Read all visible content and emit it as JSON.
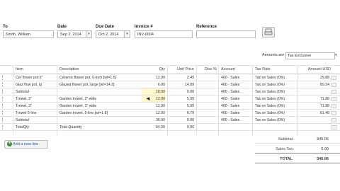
{
  "header": {
    "to_label": "To",
    "to_value": "Smith, William",
    "date_label": "Date",
    "date_value": "Sep 2, 2014",
    "due_label": "Due Date",
    "due_value": "Oct 2, 2014",
    "invoice_label": "Invoice #",
    "invoice_value": "INV-0004",
    "reference_label": "Reference",
    "reference_value": ""
  },
  "amounts": {
    "label": "Amounts are",
    "value": "Tax Exclusive"
  },
  "columns": [
    "Item",
    "Description",
    "Qty",
    "Unit Price",
    "Disc %",
    "Account",
    "Tax Rate",
    "Amount USD"
  ],
  "rows": [
    {
      "item": "Cer flower pot 6\"",
      "desc": "Ceramic flower pot, 6-inch [wt=1.5]",
      "qty": "12.00",
      "price": "2.49",
      "disc": "",
      "account": "400 - Sales",
      "tax": "Tax on Sales (0%)",
      "amount": "29.88",
      "hl": false
    },
    {
      "item": "Glaz flow pot, lg",
      "desc": "Glazed flower pot, large [wt=14.3]",
      "qty": "6.00",
      "price": "14.89",
      "disc": "",
      "account": "400 - Sales",
      "tax": "Tax on Sales (0%)",
      "amount": "89.34",
      "hl": false
    },
    {
      "item": "Subtotal",
      "desc": "",
      "qty": "18.00",
      "price": "0.00",
      "disc": "",
      "account": "400 - Sales",
      "tax": "Tax on Sales (0%)",
      "amount": "",
      "hl": true
    },
    {
      "item": "Trowel, 2\"",
      "desc": "Garden trowel, 2\" wide",
      "qty": "12.00",
      "price": "5.99",
      "disc": "",
      "account": "400 - Sales",
      "tax": "Tax on Sales (0%)",
      "amount": "71.88",
      "hl": true
    },
    {
      "item": "Trowel, 3\"",
      "desc": "Garden trowel, 3\" wide",
      "qty": "12.00",
      "price": "5.99",
      "disc": "",
      "account": "400 - Sales",
      "tax": "Tax on Sales (0%)",
      "amount": "71.88",
      "hl": false
    },
    {
      "item": "Trowel 5-line",
      "desc": "Garden trowel, 5-line [wt=1.8]",
      "qty": "12.00",
      "price": "6.79",
      "disc": "",
      "account": "400 - Sales",
      "tax": "Tax on Sales (0%)",
      "amount": "81.48",
      "hl": false
    },
    {
      "item": "Subtotal",
      "desc": "",
      "qty": "36.00",
      "price": "0.00",
      "disc": "",
      "account": "400 - Sales",
      "tax": "Tax on Sales (0%)",
      "amount": "",
      "hl": false
    },
    {
      "item": "TotalQty",
      "desc": "Total Quantity",
      "qty": "54.00",
      "price": "0.00",
      "disc": "",
      "account": "",
      "tax": "",
      "amount": "",
      "hl": false
    }
  ],
  "add_row_label": "Add a new line",
  "totals": {
    "subtotal_label": "Subtotal",
    "subtotal_value": "345.06",
    "tax_label": "Sales Tax",
    "tax_value": "0.00",
    "total_label": "TOTAL",
    "total_value": "345.06"
  }
}
